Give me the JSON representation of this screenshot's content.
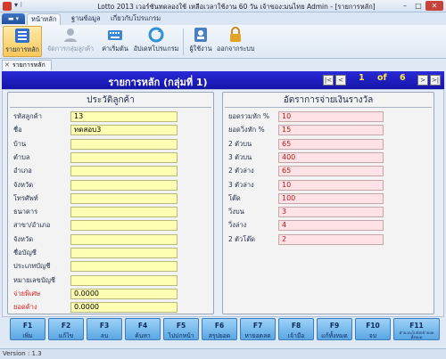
{
  "window": {
    "title": "Lotto 2013 เวอร์ชันทดลองใช้ เหลือเวลาใช้งาน 60 วัน เจ้าของ:มนไทย Admin - [รายการหลัก]",
    "quick_access": "▾ ⁝",
    "min": "–",
    "max": "□",
    "close": "✕"
  },
  "ribbon": {
    "app_menu": "▬ ▾",
    "tabs": [
      "หน้าหลัก",
      "ฐานข้อมูล",
      "เกี่ยวกับโปรแกรม"
    ],
    "buttons": [
      {
        "label": "รายการหลัก",
        "icon": "list-icon",
        "color": "#2f6fd0"
      },
      {
        "label": "จัดการกลุ่มลูกค้า",
        "icon": "users-icon",
        "color": "#9aa6b5"
      },
      {
        "label": "ค่าเริ่มต้น",
        "icon": "keyboard-icon",
        "color": "#3a86d6"
      },
      {
        "label": "อัปเดทโปรแกรม",
        "icon": "update-icon",
        "color": "#2f92d6"
      },
      {
        "label": "ผู้ใช้งาน",
        "icon": "user-icon",
        "color": "#4a7fc3"
      },
      {
        "label": "ออกจากระบบ",
        "icon": "lock-icon",
        "color": "#e0a526"
      }
    ]
  },
  "doc_tab": {
    "close": "✕",
    "label": "รายการหลัก"
  },
  "header": {
    "title": "รายการหลัก (กลุ่มที่ 1)",
    "nav_first": "|<",
    "nav_prev": "<",
    "page_current": "1",
    "page_of": "of",
    "page_total": "6",
    "nav_next": ">",
    "nav_last": ">|"
  },
  "customer": {
    "title": "ประวัติลูกค้า",
    "fields": [
      {
        "label": "รหัสลูกค้า",
        "value": ""
      },
      {
        "label": "ชื่อ",
        "value": "ทดสอบ3"
      },
      {
        "label": "บ้าน",
        "value": ""
      },
      {
        "label": "ตำบล",
        "value": ""
      },
      {
        "label": "อำเภอ",
        "value": ""
      },
      {
        "label": "จังหวัด",
        "value": ""
      },
      {
        "label": "โทรศัพท์",
        "value": ""
      },
      {
        "label": "ธนาคาร",
        "value": ""
      },
      {
        "label": "สาขา/อำเภอ",
        "value": ""
      },
      {
        "label": "จังหวัด",
        "value": ""
      },
      {
        "label": "ชื่อบัญชี",
        "value": ""
      },
      {
        "label": "ประเภทบัญชี",
        "value": ""
      },
      {
        "label": "หมายเลขบัญชี",
        "value": ""
      },
      {
        "label": "จ่ายพิเศษ",
        "value": "0.0000"
      },
      {
        "label": "ยอดค้าง",
        "value": "0.0000"
      }
    ],
    "code_value": "13"
  },
  "payout": {
    "title": "อัตราการจ่ายเงินรางวัล",
    "fields": [
      {
        "label": "ยอดรวมหัก %",
        "value": "10"
      },
      {
        "label": "ยอดวิ่งหัก %",
        "value": "15"
      },
      {
        "label": "2 ตัวบน",
        "value": "65"
      },
      {
        "label": "3 ตัวบน",
        "value": "400"
      },
      {
        "label": "2 ตัวล่าง",
        "value": "65"
      },
      {
        "label": "3 ตัวล่าง",
        "value": "10"
      },
      {
        "label": "โต๊ด",
        "value": "100"
      },
      {
        "label": "วิ่งบน",
        "value": "3"
      },
      {
        "label": "วิ่งล่าง",
        "value": "4"
      },
      {
        "label": "2 ตัวโต๊ด",
        "value": "2"
      }
    ]
  },
  "fkeys": [
    {
      "key": "F1",
      "action": "เพิ่ม"
    },
    {
      "key": "F2",
      "action": "แก้ไข"
    },
    {
      "key": "F3",
      "action": "ลบ"
    },
    {
      "key": "F4",
      "action": "ค้นหา"
    },
    {
      "key": "F5",
      "action": "ไปปกหน้า"
    },
    {
      "key": "F6",
      "action": "สรุปยอด"
    },
    {
      "key": "F7",
      "action": "หายอดลด"
    },
    {
      "key": "F8",
      "action": "เจ้ามือ"
    },
    {
      "key": "F9",
      "action": "แก้ทั้งหมด"
    },
    {
      "key": "F10",
      "action": "จบ"
    },
    {
      "key": "F11",
      "action": "คำนวณโบนัสเข้ายอดทั้งหมด"
    }
  ],
  "status": {
    "version": "Version : 1.3"
  }
}
